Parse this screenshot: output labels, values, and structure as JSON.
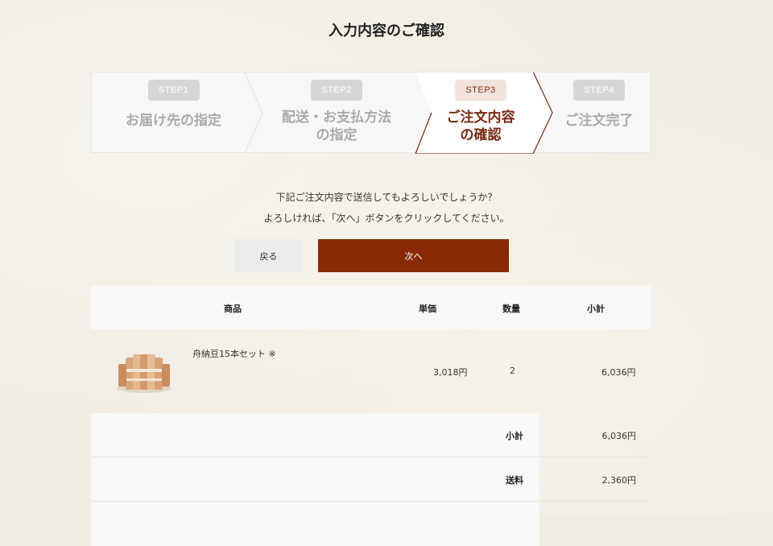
{
  "page": {
    "title": "入力内容のご確認"
  },
  "steps": [
    {
      "badge": "STEP1",
      "label_lines": [
        "お届け先の指定"
      ],
      "active": false
    },
    {
      "badge": "STEP2",
      "label_lines": [
        "配送・お支払方法",
        "の指定"
      ],
      "active": false
    },
    {
      "badge": "STEP3",
      "label_lines": [
        "ご注文内容",
        "の確認"
      ],
      "active": true
    },
    {
      "badge": "STEP4",
      "label_lines": [
        "ご注文完了"
      ],
      "active": false
    }
  ],
  "message": {
    "line1": "下記ご注文内容で送信してもよろしいでしょうか？",
    "line2": "よろしければ、「次へ」ボタンをクリックしてください。"
  },
  "buttons": {
    "back": "戻る",
    "next": "次へ"
  },
  "table": {
    "headers": {
      "product": "商品",
      "unit_price": "単価",
      "quantity": "数量",
      "subtotal": "小計"
    },
    "items": [
      {
        "name": "舟納豆15本セット ※",
        "unit_price": "3,018円",
        "quantity": "2",
        "subtotal": "6,036円"
      }
    ]
  },
  "summary": [
    {
      "label": "小計",
      "value": "6,036円"
    },
    {
      "label": "送料",
      "value": "2,360円"
    }
  ],
  "colors": {
    "accent": "#882a06",
    "active_step_text": "#7a2a12",
    "background": "#f3eee3"
  }
}
